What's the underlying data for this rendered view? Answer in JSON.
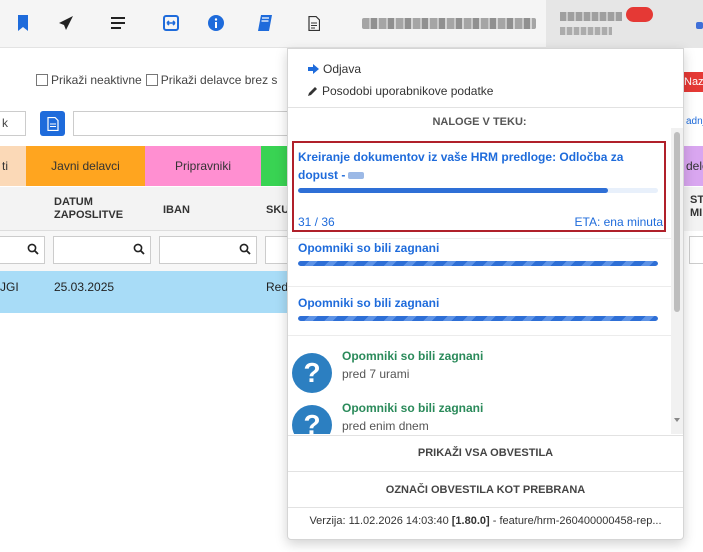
{
  "toolbar": {
    "icons": [
      "bookmark-icon",
      "send-icon",
      "list-icon",
      "expand-icon",
      "info-icon",
      "book-icon",
      "document-icon"
    ],
    "accent": "#1e6bdb"
  },
  "filters": {
    "show_inactive": "Prikaži neaktivne",
    "show_no_employee": "Prikaži delavce brez s"
  },
  "header_right": {
    "back_label": "Nazaj",
    "right_link": "adnja"
  },
  "left_field": {
    "value": "k"
  },
  "categories": [
    {
      "label": "ti",
      "color": "#fbd9b7"
    },
    {
      "label": "Javni delavci",
      "color": "#ffa51f"
    },
    {
      "label": "Pripravniki",
      "color": "#ff8fd1"
    },
    {
      "label": "",
      "color": "#39d353"
    }
  ],
  "right_category": "delc",
  "grid": {
    "columns": [
      "DATUM ZAPOSLITVE",
      "IBAN",
      "SKU"
    ],
    "right_column": "ST MI",
    "row": {
      "left_fragment": "JGI",
      "date": "25.03.2025",
      "right_fragment": "Red"
    }
  },
  "dropdown": {
    "logout": "Odjava",
    "update_user": "Posodobi uporabnikove podatke",
    "section_title": "NALOGE V TEKU:",
    "tasks": [
      {
        "title": "Kreiranje dokumentov iz vaše HRM predloge: Odločba za dopust -",
        "progress_current": 31,
        "progress_total": 36,
        "progress_text": "31 / 36",
        "eta": "ETA: ena minuta"
      },
      {
        "title": "Opomniki so bili zagnani",
        "progress_fraction": 1.0
      },
      {
        "title": "Opomniki so bili zagnani",
        "progress_fraction": 1.0
      }
    ],
    "notifications": [
      {
        "title": "Opomniki so bili zagnani",
        "time": "pred 7 urami"
      },
      {
        "title": "Opomniki so bili zagnani",
        "time": "pred enim dnem"
      }
    ],
    "show_all": "PRIKAŽI VSA OBVESTILA",
    "mark_read": "OZNAČI OBVESTILA KOT PREBRANA",
    "version_prefix": "Verzija: 11.02.2026 14:03:40",
    "version_number": "[1.80.0]",
    "version_branch": "- feature/hrm-260400000458-rep..."
  }
}
